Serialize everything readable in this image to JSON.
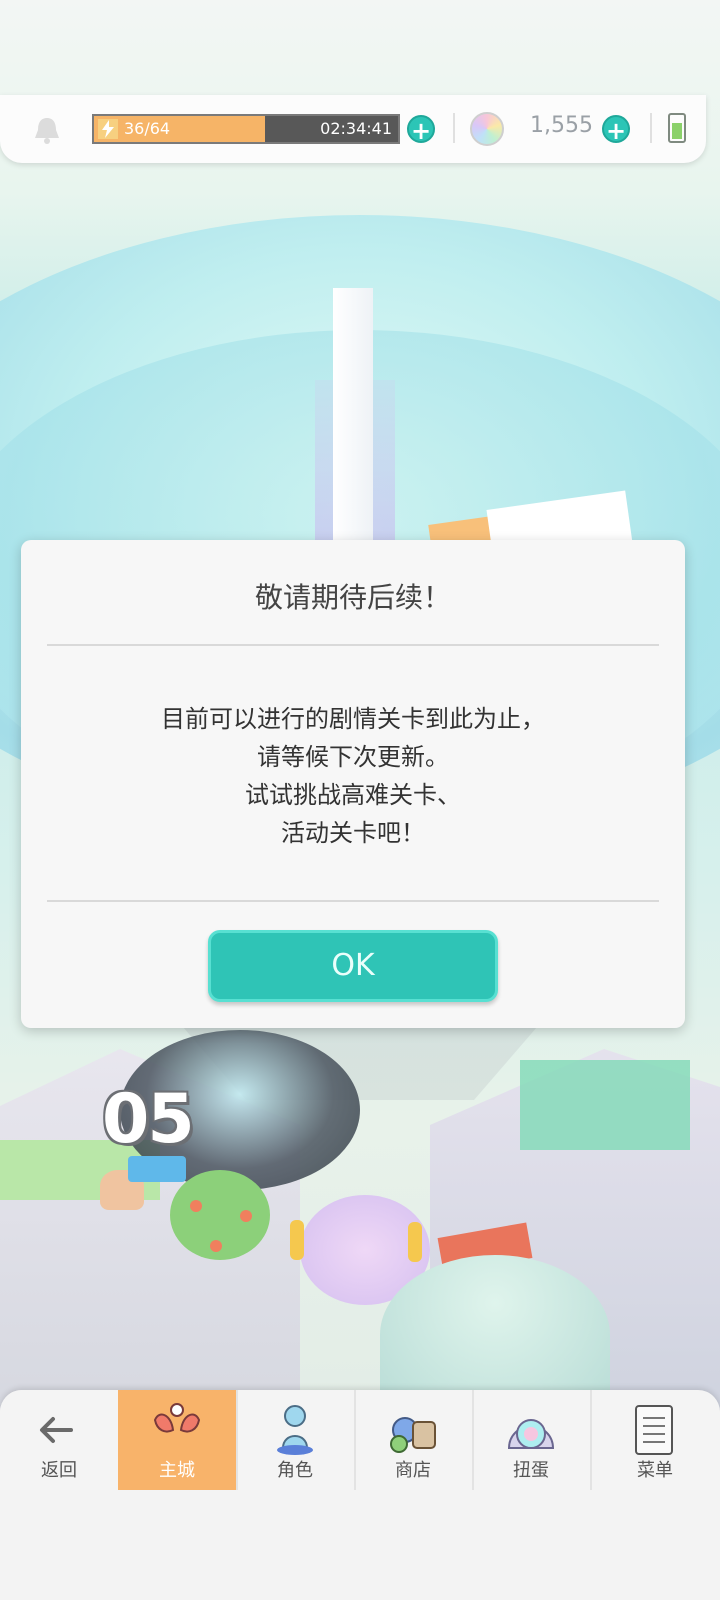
{
  "status_bar": {
    "stamina_value": "36/64",
    "stamina_fraction": 0.5625,
    "stamina_timer": "02:34:41",
    "gem_count": "1,555"
  },
  "dialog": {
    "title": "敬请期待后续！",
    "lines": [
      "目前可以进行的剧情关卡到此为止，",
      "请等候下次更新。",
      "试试挑战高难关卡、",
      "活动关卡吧！"
    ],
    "ok_label": "OK"
  },
  "scene": {
    "stage_number": "05"
  },
  "nav": {
    "items": [
      {
        "label": "返回",
        "icon": "back-arrow-icon"
      },
      {
        "label": "主城",
        "icon": "home-city-icon"
      },
      {
        "label": "角色",
        "icon": "character-icon"
      },
      {
        "label": "商店",
        "icon": "shop-icon"
      },
      {
        "label": "扭蛋",
        "icon": "gacha-icon"
      },
      {
        "label": "菜单",
        "icon": "menu-list-icon"
      }
    ]
  },
  "colors": {
    "accent": "#2fc4b6",
    "stamina": "#f6b467",
    "active_tab": "#f8b36a"
  }
}
